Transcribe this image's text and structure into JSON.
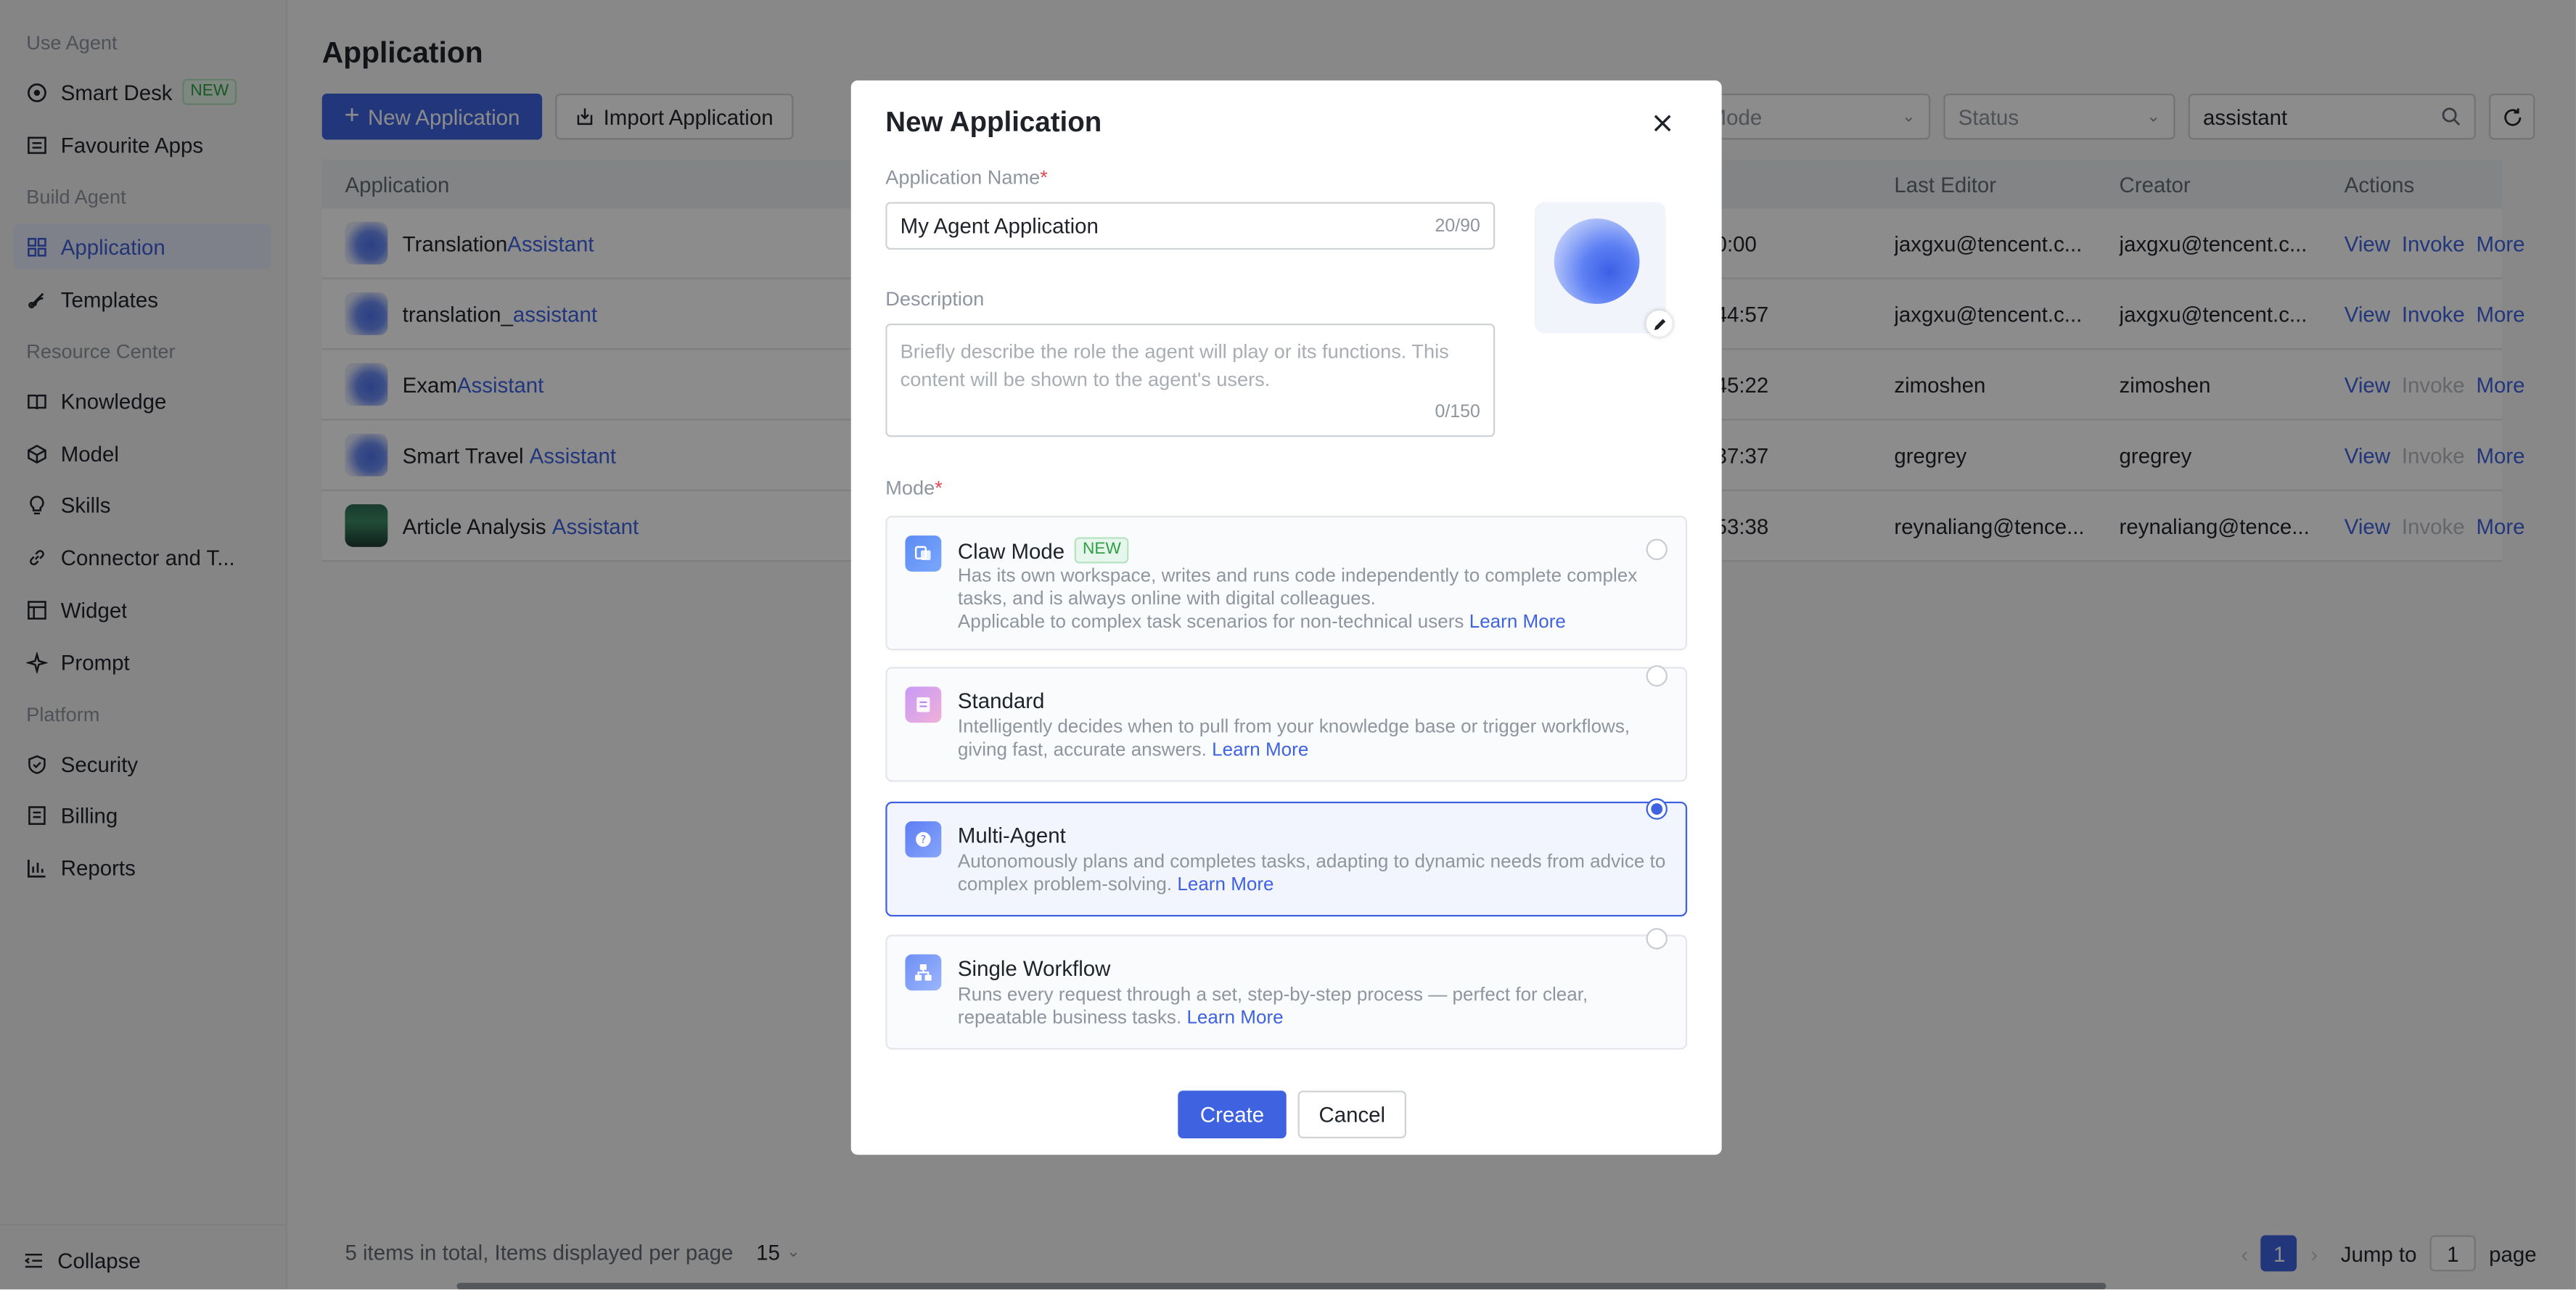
{
  "sidebar": {
    "sections": [
      "Use Agent",
      "Build Agent",
      "Resource Center",
      "Platform"
    ],
    "items": [
      {
        "label": "Smart Desk",
        "badge": "NEW",
        "icon": "smart-desk-icon"
      },
      {
        "label": "Favourite Apps",
        "icon": "list-icon"
      },
      {
        "label": "Application",
        "icon": "grid-icon"
      },
      {
        "label": "Templates",
        "icon": "templates-icon"
      },
      {
        "label": "Knowledge",
        "icon": "book-icon"
      },
      {
        "label": "Model",
        "icon": "cube-icon"
      },
      {
        "label": "Skills",
        "icon": "bulb-icon"
      },
      {
        "label": "Connector and T...",
        "icon": "link-icon"
      },
      {
        "label": "Widget",
        "icon": "widget-icon"
      },
      {
        "label": "Prompt",
        "icon": "sparkle-icon"
      },
      {
        "label": "Security",
        "icon": "shield-icon"
      },
      {
        "label": "Billing",
        "icon": "billing-icon"
      },
      {
        "label": "Reports",
        "icon": "chart-icon"
      }
    ],
    "collapse_label": "Collapse"
  },
  "page": {
    "title": "Application",
    "new_button": "New Application",
    "import_button": "Import Application",
    "filter_mode": "Mode",
    "filter_status": "Status",
    "search_value": "assistant"
  },
  "table": {
    "columns": [
      "Application",
      "Last Editor",
      "Creator",
      "Actions"
    ],
    "rows": [
      {
        "name_pre": "Translation",
        "name_hl": "Assistant",
        "time": "0:00",
        "editor": "jaxgxu@tencent.c...",
        "creator": "jaxgxu@tencent.c...",
        "view": "View",
        "invoke": "Invoke",
        "more": "More"
      },
      {
        "name_pre": "translation_",
        "name_hl": "assistant",
        "time": "44:57",
        "editor": "jaxgxu@tencent.c...",
        "creator": "jaxgxu@tencent.c...",
        "view": "View",
        "invoke": "Invoke",
        "more": "More"
      },
      {
        "name_pre": "Exam",
        "name_hl": "Assistant",
        "time": "45:22",
        "editor": "zimoshen",
        "creator": "zimoshen",
        "view": "View",
        "invoke": "Invoke",
        "more": "More"
      },
      {
        "name_pre": "Smart Travel ",
        "name_hl": "Assistant",
        "time": "37:37",
        "editor": "gregrey",
        "creator": "gregrey",
        "view": "View",
        "invoke": "Invoke",
        "more": "More"
      },
      {
        "name_pre": "Article Analysis ",
        "name_hl": "Assistant",
        "time": "53:38",
        "editor": "reynaliang@tence...",
        "creator": "reynaliang@tence...",
        "view": "View",
        "invoke": "Invoke",
        "more": "More"
      }
    ]
  },
  "footer": {
    "total_text": "5 items in total, Items displayed per page",
    "page_size": "15",
    "current_page": "1",
    "jump_label": "Jump to",
    "jump_value": "1",
    "page_label": "page"
  },
  "modal": {
    "title": "New Application",
    "name_label": "Application Name",
    "name_value": "My Agent Application",
    "name_count": "20/90",
    "desc_label": "Description",
    "desc_placeholder": "Briefly describe the role the agent will play or its functions. This content will be shown to the agent's users.",
    "desc_count": "0/150",
    "mode_label": "Mode",
    "modes": [
      {
        "name": "Claw Mode",
        "badge": "NEW",
        "desc": "Has its own workspace, writes and runs code independently to complete complex tasks, and is always online with digital colleagues.",
        "desc2": "Applicable to complex task scenarios for non-technical users",
        "learn": "Learn More",
        "selected": false
      },
      {
        "name": "Standard",
        "desc": "Intelligently decides when to pull from your knowledge base or trigger workflows, giving fast, accurate answers.",
        "learn": "Learn More",
        "selected": false
      },
      {
        "name": "Multi-Agent",
        "desc": "Autonomously plans and completes tasks, adapting to dynamic needs from advice to complex problem-solving.",
        "learn": "Learn More",
        "selected": true
      },
      {
        "name": "Single Workflow",
        "desc": "Runs every request through a set, step-by-step process — perfect for clear, repeatable business tasks.",
        "learn": "Learn More",
        "selected": false
      }
    ],
    "create_button": "Create",
    "cancel_button": "Cancel"
  },
  "colors": {
    "accent": "#3f63e0",
    "new_badge": "#2ea043",
    "required": "#e5484d"
  }
}
